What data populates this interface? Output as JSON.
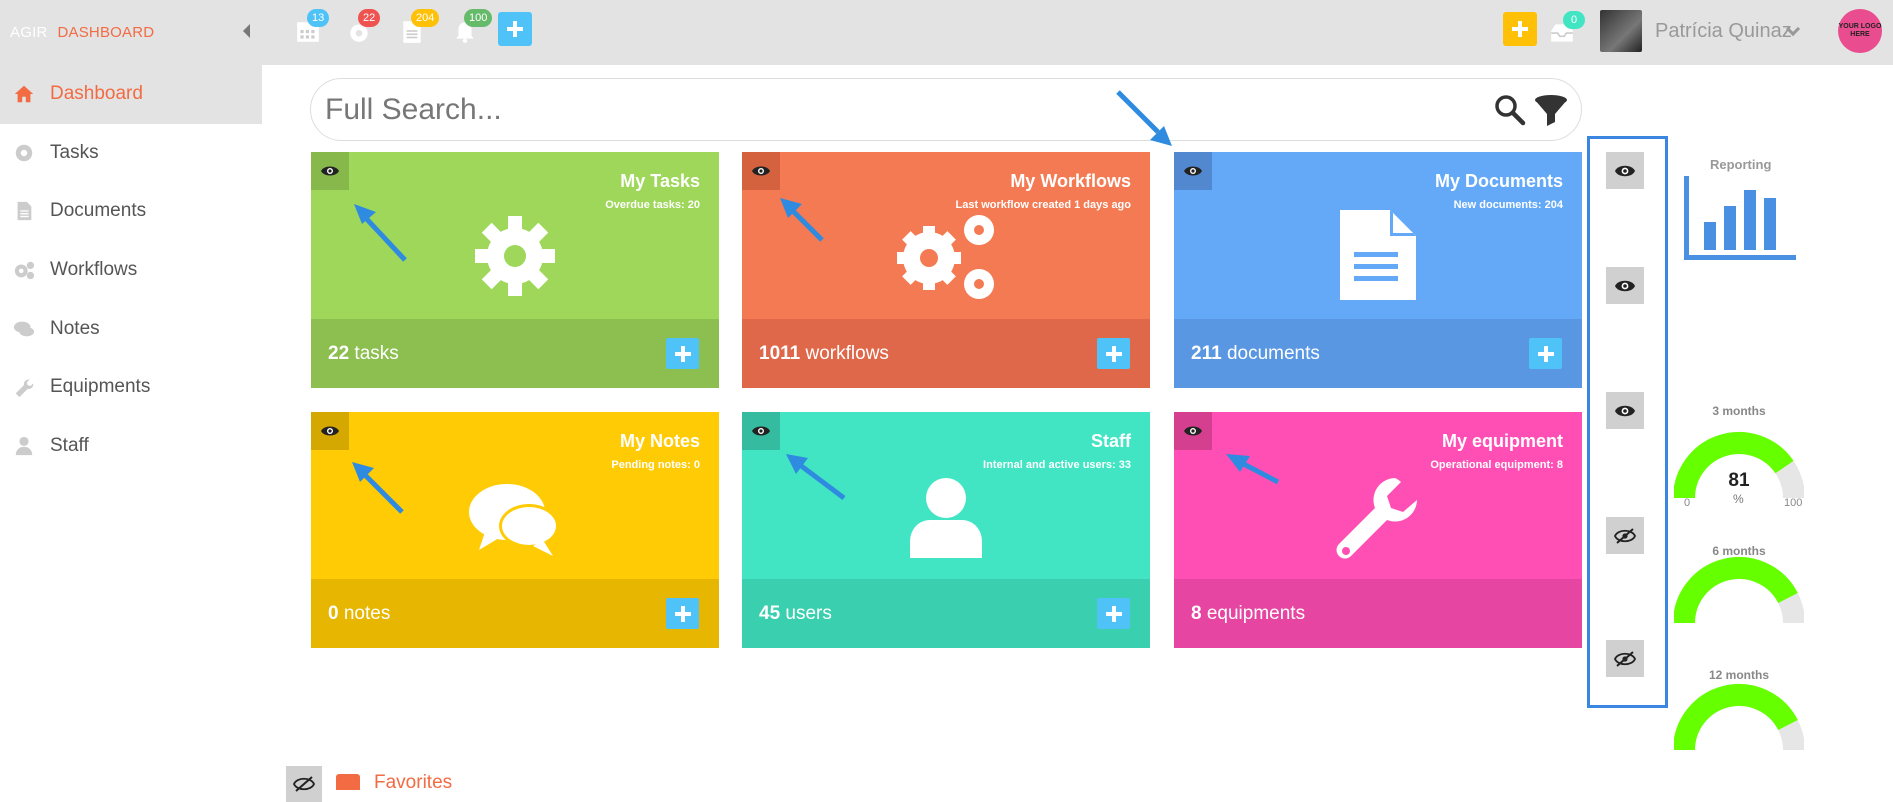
{
  "topbar": {
    "brand": "AGIR",
    "section": "DASHBOARD",
    "notifications": [
      {
        "icon": "calendar-icon",
        "count": "13",
        "color": "#4fc3f7"
      },
      {
        "icon": "gear-icon",
        "count": "22",
        "color": "#ef5350"
      },
      {
        "icon": "document-icon",
        "count": "204",
        "color": "#ffc107"
      },
      {
        "icon": "bell-icon",
        "count": "100",
        "color": "#66bb6a"
      }
    ],
    "inbox_count": "0",
    "user_name": "Patrícia Quinaz",
    "logo_text": "YOUR LOGO HERE",
    "colors": {
      "add_blue": "#4fc3f7",
      "add_yellow": "#ffc107",
      "accent": "#f26b43"
    }
  },
  "sidebar": {
    "items": [
      {
        "label": "Dashboard",
        "icon": "home-icon",
        "active": true
      },
      {
        "label": "Tasks",
        "icon": "gear-icon"
      },
      {
        "label": "Documents",
        "icon": "document-icon"
      },
      {
        "label": "Workflows",
        "icon": "gears-icon"
      },
      {
        "label": "Notes",
        "icon": "chat-icon"
      },
      {
        "label": "Equipments",
        "icon": "wrench-icon"
      },
      {
        "label": "Staff",
        "icon": "user-icon"
      }
    ]
  },
  "search": {
    "placeholder": "Full Search..."
  },
  "cards": [
    {
      "title": "My Tasks",
      "subtitle": "Overdue tasks: 20",
      "count": "22",
      "unit": "tasks",
      "icon": "gear-icon",
      "color_top": "#9ed75a",
      "color_bottom": "#8cbf4f"
    },
    {
      "title": "My Workflows",
      "subtitle": "Last workflow created 1 days ago",
      "count": "1011",
      "unit": "workflows",
      "icon": "gears-icon",
      "color_top": "#f47a53",
      "color_bottom": "#e0684a"
    },
    {
      "title": "My Documents",
      "subtitle": "New documents: 204",
      "count": "211",
      "unit": "documents",
      "icon": "document-icon",
      "color_top": "#64a9f7",
      "color_bottom": "#5997e3"
    },
    {
      "title": "My Notes",
      "subtitle": "Pending notes: 0",
      "count": "0",
      "unit": "notes",
      "icon": "chat-icon",
      "color_top": "#ffcb05",
      "color_bottom": "#e6b600"
    },
    {
      "title": "Staff",
      "subtitle": "Internal and active users: 33",
      "count": "45",
      "unit": "users",
      "icon": "user-icon",
      "color_top": "#42e5c3",
      "color_bottom": "#3acfae"
    },
    {
      "title": "My equipment",
      "subtitle": "Operational equipment: 8",
      "count": "8",
      "unit": "equipments",
      "icon": "wrench-icon",
      "color_top": "#ff4fb5",
      "color_bottom": "#e645a2"
    }
  ],
  "visibility_toggles": [
    {
      "state": "visible",
      "icon": "eye-icon"
    },
    {
      "state": "visible",
      "icon": "eye-icon"
    },
    {
      "state": "visible",
      "icon": "eye-icon"
    },
    {
      "state": "hidden",
      "icon": "eye-slash-icon"
    },
    {
      "state": "hidden",
      "icon": "eye-slash-icon"
    }
  ],
  "widgets": {
    "reporting_label": "Reporting",
    "gauges": [
      {
        "label": "3 months",
        "value": "81",
        "unit": "%",
        "min": "0",
        "max": "100",
        "fraction": 0.81
      },
      {
        "label": "6 months",
        "fraction": 0.85
      },
      {
        "label": "12 months",
        "fraction": 0.85
      }
    ],
    "gauge_color": "#66ff00"
  },
  "favorites": {
    "label": "Favorites"
  }
}
